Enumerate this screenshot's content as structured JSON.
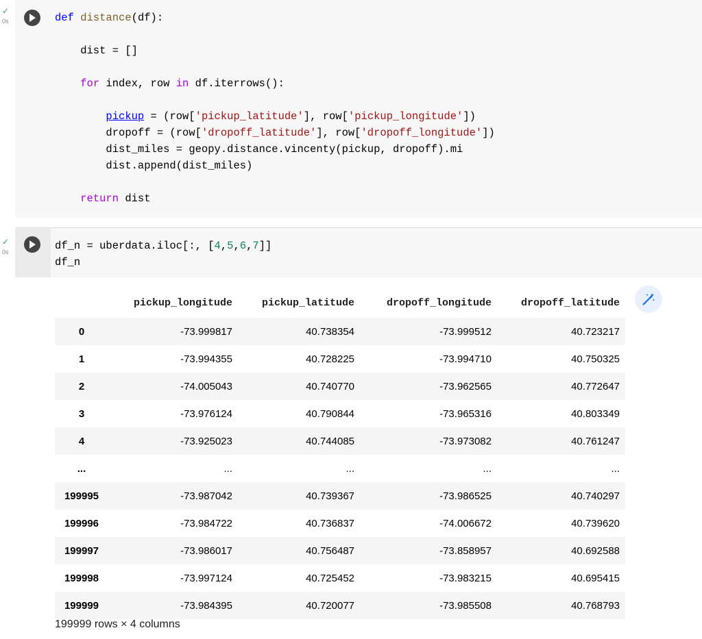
{
  "cell1": {
    "status": "✓",
    "exec_time": "0s",
    "code_lines": [
      [
        {
          "t": "def",
          "c": "kw"
        },
        {
          "t": " "
        },
        {
          "t": "distance",
          "c": "fn"
        },
        {
          "t": "(df):"
        }
      ],
      [],
      [
        {
          "t": "    dist = []"
        }
      ],
      [],
      [
        {
          "t": "    "
        },
        {
          "t": "for",
          "c": "kw2"
        },
        {
          "t": " index, row "
        },
        {
          "t": "in",
          "c": "kw2"
        },
        {
          "t": " df.iterrows():"
        }
      ],
      [],
      [
        {
          "t": "        "
        },
        {
          "t": "pickup",
          "c": "ulink"
        },
        {
          "t": " = (row["
        },
        {
          "t": "'pickup_latitude'",
          "c": "str"
        },
        {
          "t": "], row["
        },
        {
          "t": "'pickup_longitude'",
          "c": "str"
        },
        {
          "t": "])"
        }
      ],
      [
        {
          "t": "        dropoff = (row["
        },
        {
          "t": "'dropoff_latitude'",
          "c": "str"
        },
        {
          "t": "], row["
        },
        {
          "t": "'dropoff_longitude'",
          "c": "str"
        },
        {
          "t": "])"
        }
      ],
      [
        {
          "t": "        dist_miles = geopy.distance.vincenty(pickup, dropoff).mi"
        }
      ],
      [
        {
          "t": "        dist.append(dist_miles)"
        }
      ],
      [],
      [
        {
          "t": "    "
        },
        {
          "t": "return",
          "c": "kw2"
        },
        {
          "t": " dist"
        }
      ]
    ]
  },
  "cell2": {
    "status": "✓",
    "exec_time": "0s",
    "code_lines": [
      [
        {
          "t": "df_n = uberdata.iloc[:, ["
        },
        {
          "t": "4",
          "c": "num"
        },
        {
          "t": ","
        },
        {
          "t": "5",
          "c": "num"
        },
        {
          "t": ","
        },
        {
          "t": "6",
          "c": "num"
        },
        {
          "t": ","
        },
        {
          "t": "7",
          "c": "num"
        },
        {
          "t": "]]"
        }
      ],
      [
        {
          "t": "df_n"
        }
      ]
    ]
  },
  "table": {
    "columns": [
      "",
      "pickup_longitude",
      "pickup_latitude",
      "dropoff_longitude",
      "dropoff_latitude"
    ],
    "rows": [
      [
        "0",
        "-73.999817",
        "40.738354",
        "-73.999512",
        "40.723217"
      ],
      [
        "1",
        "-73.994355",
        "40.728225",
        "-73.994710",
        "40.750325"
      ],
      [
        "2",
        "-74.005043",
        "40.740770",
        "-73.962565",
        "40.772647"
      ],
      [
        "3",
        "-73.976124",
        "40.790844",
        "-73.965316",
        "40.803349"
      ],
      [
        "4",
        "-73.925023",
        "40.744085",
        "-73.973082",
        "40.761247"
      ],
      [
        "...",
        "...",
        "...",
        "...",
        "..."
      ],
      [
        "199995",
        "-73.987042",
        "40.739367",
        "-73.986525",
        "40.740297"
      ],
      [
        "199996",
        "-73.984722",
        "40.736837",
        "-74.006672",
        "40.739620"
      ],
      [
        "199997",
        "-73.986017",
        "40.756487",
        "-73.858957",
        "40.692588"
      ],
      [
        "199998",
        "-73.997124",
        "40.725452",
        "-73.983215",
        "40.695415"
      ],
      [
        "199999",
        "-73.984395",
        "40.720077",
        "-73.985508",
        "40.768793"
      ]
    ],
    "shape": "199999 rows × 4 columns"
  },
  "icons": {
    "run": "play-icon",
    "magic": "magic-wand-icon"
  }
}
